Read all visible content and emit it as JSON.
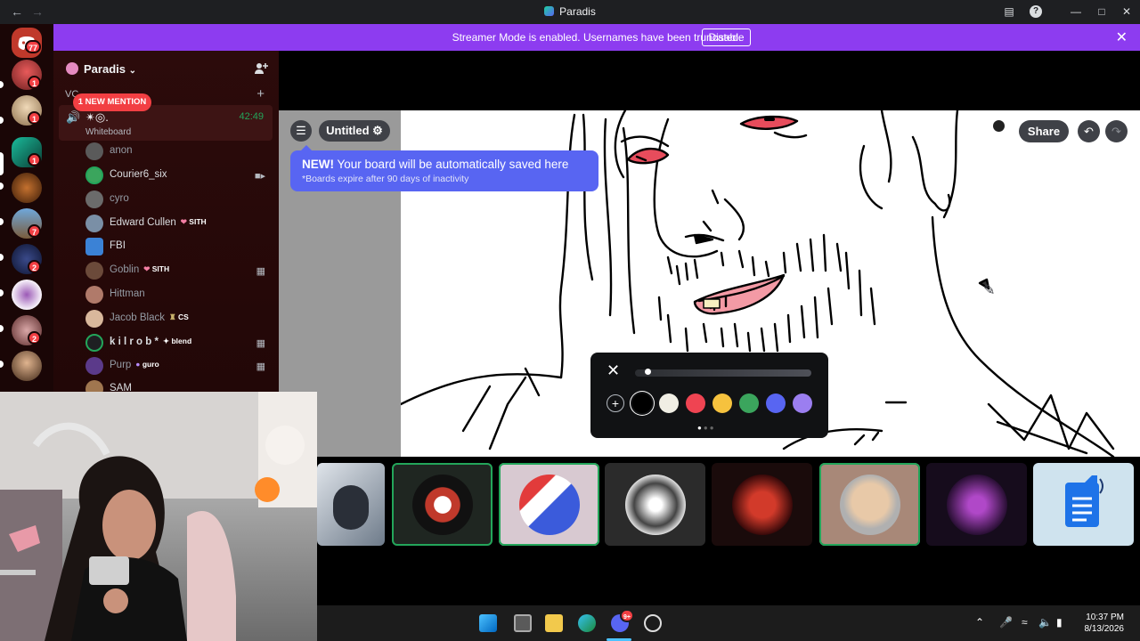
{
  "window": {
    "title": "Paradis"
  },
  "banner": {
    "message": "Streamer Mode is enabled. Usernames have been truncated.",
    "disable_label": "Disable"
  },
  "rail": {
    "home_badge": "77",
    "badges": [
      "1",
      "1",
      "1",
      "7",
      "2",
      "2"
    ]
  },
  "sidebar": {
    "server_name": "Paradis",
    "category": "VC",
    "mention_pill": "1 NEW MENTION",
    "voice_channel": {
      "name": "✴︎◎.",
      "activity": "Whiteboard",
      "timer": "42:49"
    },
    "members": [
      {
        "name": "anon",
        "dim": true,
        "tag": ""
      },
      {
        "name": "Courier6_six",
        "dim": false,
        "tag": ""
      },
      {
        "name": "cyro",
        "dim": true,
        "tag": ""
      },
      {
        "name": "Edward Cullen",
        "dim": false,
        "tag": "SITH"
      },
      {
        "name": "FBI",
        "dim": false,
        "tag": ""
      },
      {
        "name": "Goblin",
        "dim": true,
        "tag": "SITH"
      },
      {
        "name": "Hittman",
        "dim": true,
        "tag": ""
      },
      {
        "name": "Jacob Black",
        "dim": true,
        "tag": "CS"
      },
      {
        "name": "k i l r o b *",
        "dim": false,
        "tag": "blend"
      },
      {
        "name": "Purp",
        "dim": true,
        "tag": "guro"
      },
      {
        "name": "SAM",
        "dim": false,
        "tag": ""
      }
    ]
  },
  "whiteboard": {
    "board_title": "Untitled",
    "tooltip_strong": "NEW!",
    "tooltip_text": "Your board will be automatically saved here",
    "tooltip_sub": "*Boards expire after 90 days of inactivity",
    "share_label": "Share",
    "brush_size": 0.07,
    "colors": [
      "#000000",
      "#f0eee4",
      "#ef4452",
      "#f6c23e",
      "#3ba55d",
      "#5865f2",
      "#9b7ef0"
    ],
    "selected_color": "#000000"
  },
  "taskbar": {
    "time": "10:37 PM",
    "date": "8/13/2026",
    "discord_badge": "9+"
  }
}
